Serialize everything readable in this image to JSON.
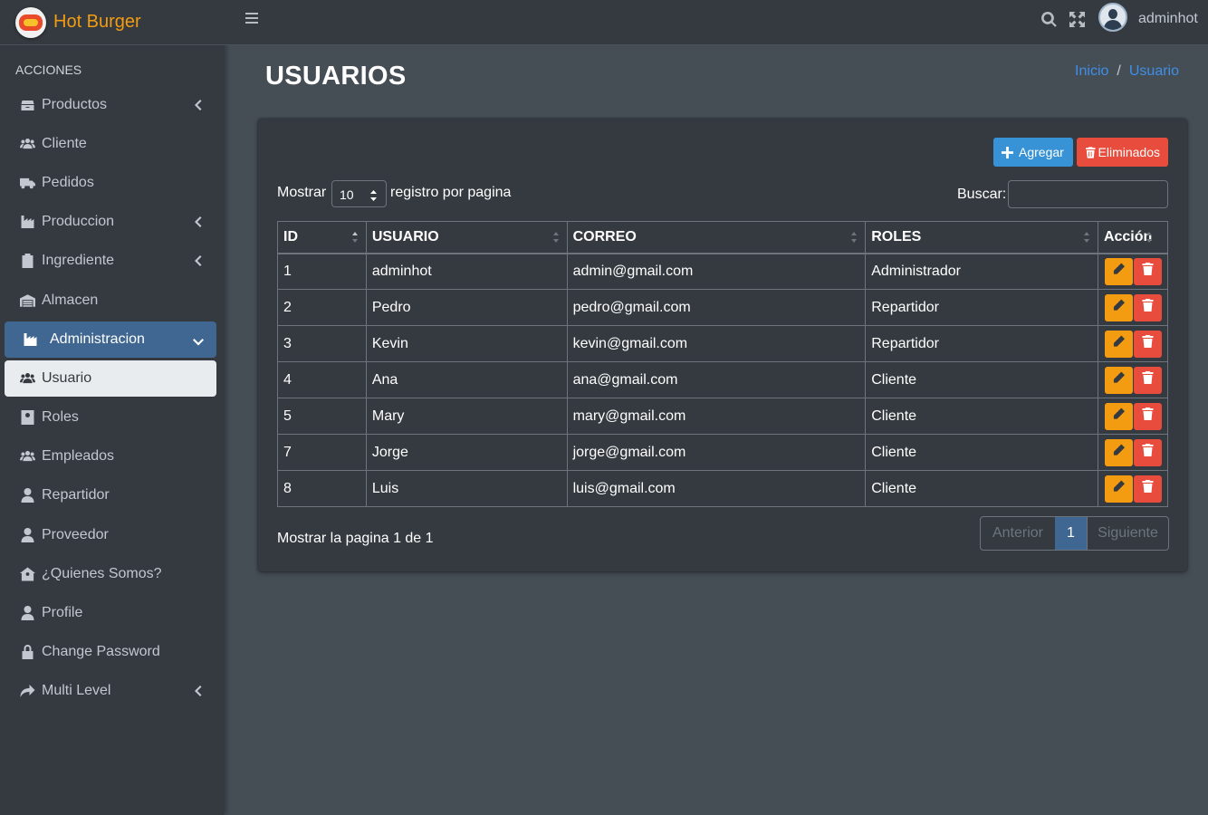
{
  "brand": {
    "name": "Hot Burger"
  },
  "sidebar": {
    "header": "ACCIONES",
    "items": [
      {
        "label": "Productos",
        "icon": "box-icon"
      },
      {
        "label": "Cliente",
        "icon": "users-icon"
      },
      {
        "label": "Pedidos",
        "icon": "truck-icon"
      },
      {
        "label": "Produccion",
        "icon": "industry-icon"
      },
      {
        "label": "Ingrediente",
        "icon": "clipboard-icon"
      },
      {
        "label": "Almacen",
        "icon": "warehouse-icon"
      },
      {
        "label": "Administracion",
        "icon": "industry-icon"
      },
      {
        "label": "Usuario",
        "icon": "users-icon"
      },
      {
        "label": "Roles",
        "icon": "id-card-icon"
      },
      {
        "label": "Empleados",
        "icon": "users-icon"
      },
      {
        "label": "Repartidor",
        "icon": "user-icon"
      },
      {
        "label": "Proveedor",
        "icon": "user-icon"
      },
      {
        "label": "¿Quienes Somos?",
        "icon": "house-user-icon"
      },
      {
        "label": "Profile",
        "icon": "user-icon"
      },
      {
        "label": "Change Password",
        "icon": "lock-icon"
      },
      {
        "label": "Multi Level",
        "icon": "share-icon"
      }
    ]
  },
  "topbar": {
    "username": "adminhot"
  },
  "page": {
    "title": "USUARIOS",
    "breadcrumb": {
      "home": "Inicio",
      "separator": "/",
      "current": "Usuario"
    }
  },
  "toolbar": {
    "add_label": "Agregar",
    "deleted_label": "Eliminados"
  },
  "datatable": {
    "show_label": "Mostrar",
    "page_size": "10",
    "show_suffix": "registro por pagina",
    "search_label": "Buscar:",
    "search_value": "",
    "columns": [
      "ID",
      "USUARIO",
      "CORREO",
      "ROLES",
      "Acción"
    ],
    "rows": [
      [
        "1",
        "adminhot",
        "admin@gmail.com",
        "Administrador"
      ],
      [
        "2",
        "Pedro",
        "pedro@gmail.com",
        "Repartidor"
      ],
      [
        "3",
        "Kevin",
        "kevin@gmail.com",
        "Repartidor"
      ],
      [
        "4",
        "Ana",
        "ana@gmail.com",
        "Cliente"
      ],
      [
        "5",
        "Mary",
        "mary@gmail.com",
        "Cliente"
      ],
      [
        "7",
        "Jorge",
        "jorge@gmail.com",
        "Cliente"
      ],
      [
        "8",
        "Luis",
        "luis@gmail.com",
        "Cliente"
      ]
    ],
    "info": "Mostrar la pagina 1 de 1",
    "pagination": {
      "prev": "Anterior",
      "current": "1",
      "next": "Siguiente"
    }
  },
  "colors": {
    "accent": "#3f6791",
    "brand": "#f39c12",
    "add": "#3793d6",
    "danger": "#e74c3c",
    "edit": "#f39c12"
  }
}
